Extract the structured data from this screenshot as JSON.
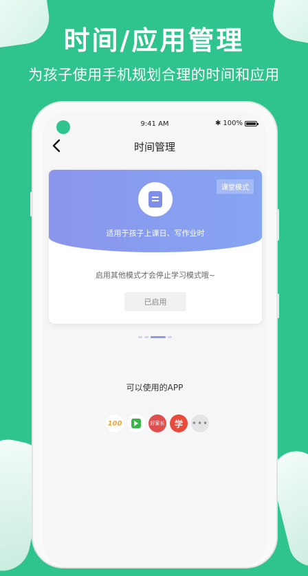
{
  "promo": {
    "headline": "时间/应用管理",
    "subline": "为孩子使用手机规划合理的时间和应用"
  },
  "status_bar": {
    "time": "9:41 AM",
    "battery": "100%"
  },
  "nav": {
    "title": "时间管理",
    "back_icon": "chevron-left-icon"
  },
  "mode_card": {
    "badge": "课堂模式",
    "icon": "document-icon",
    "description": "适用于孩子上课日、写作业时",
    "note": "启用其他模式才会停止学习模式哦~",
    "button_label": "已启用"
  },
  "carousel": {
    "count": 4,
    "active_index": 2
  },
  "apps": {
    "label": "可以使用的APP",
    "items": [
      {
        "name": "100-app-icon",
        "text": "100"
      },
      {
        "name": "video-app-icon",
        "text": ""
      },
      {
        "name": "haojiazhang-app-icon",
        "text": "好家长"
      },
      {
        "name": "xue-app-icon",
        "text": "学"
      },
      {
        "name": "more-icon",
        "text": "•••"
      }
    ]
  },
  "colors": {
    "brand_green": "#2fc48d",
    "card_accent": "#8a95ec"
  }
}
